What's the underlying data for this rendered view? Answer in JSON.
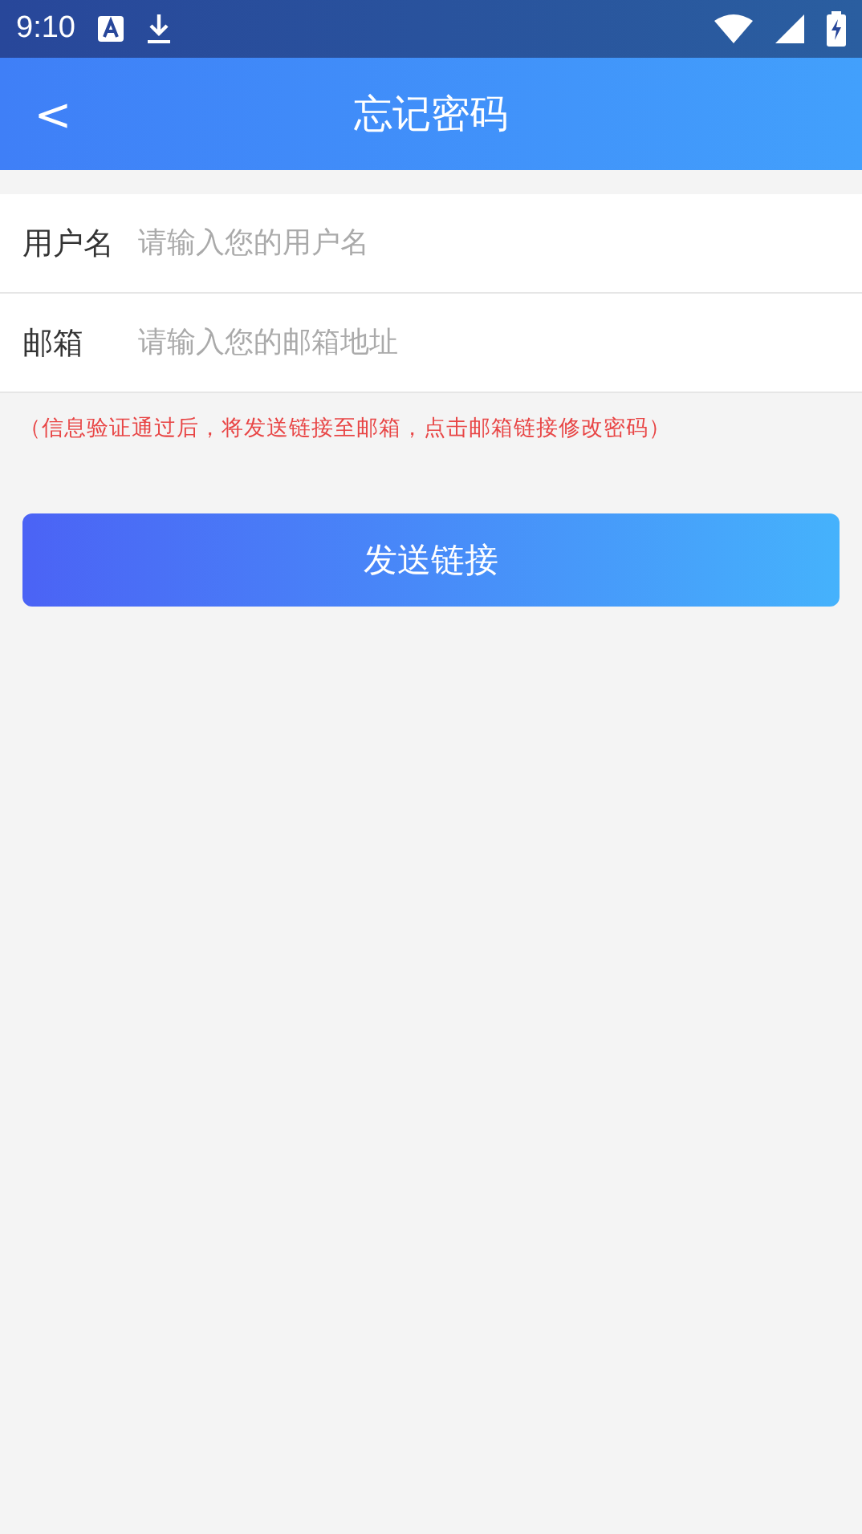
{
  "status_bar": {
    "time": "9:10"
  },
  "header": {
    "back": "<",
    "title": "忘记密码"
  },
  "fields": [
    {
      "label": "用户名",
      "placeholder": "请输入您的用户名"
    },
    {
      "label": "邮箱",
      "placeholder": "请输入您的邮箱地址"
    }
  ],
  "hint": "（信息验证通过后，将发送链接至邮箱，点击邮箱链接修改密码）",
  "submit": "发送链接"
}
